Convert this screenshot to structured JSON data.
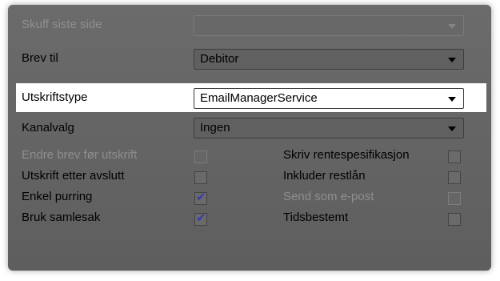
{
  "rows": {
    "skuff": {
      "label": "Skuff siste side",
      "value": "",
      "disabled": true
    },
    "brev_til": {
      "label": "Brev til",
      "value": "Debitor"
    },
    "utskriftstype": {
      "label": "Utskriftstype",
      "value": "EmailManagerService"
    },
    "kanalvalg": {
      "label": "Kanalvalg",
      "value": "Ingen"
    }
  },
  "checks_left": [
    {
      "label": "Endre brev før utskrift",
      "checked": false,
      "disabled": true
    },
    {
      "label": "Utskrift etter avslutt",
      "checked": false,
      "disabled": false
    },
    {
      "label": "Enkel purring",
      "checked": true,
      "disabled": false
    },
    {
      "label": "Bruk samlesak",
      "checked": true,
      "disabled": false
    }
  ],
  "checks_right": [
    {
      "label": "Skriv rentespesifikasjon",
      "checked": false,
      "disabled": false
    },
    {
      "label": "Inkluder restlån",
      "checked": false,
      "disabled": false
    },
    {
      "label": "Send som e-post",
      "checked": false,
      "disabled": true
    },
    {
      "label": "Tidsbestemt",
      "checked": false,
      "disabled": false
    }
  ],
  "check_mark": "✔",
  "colors": {
    "panel": "#636363",
    "highlight": "#ffffff",
    "disabled_text": "#8e8e8e",
    "check": "#3a3aa8"
  }
}
